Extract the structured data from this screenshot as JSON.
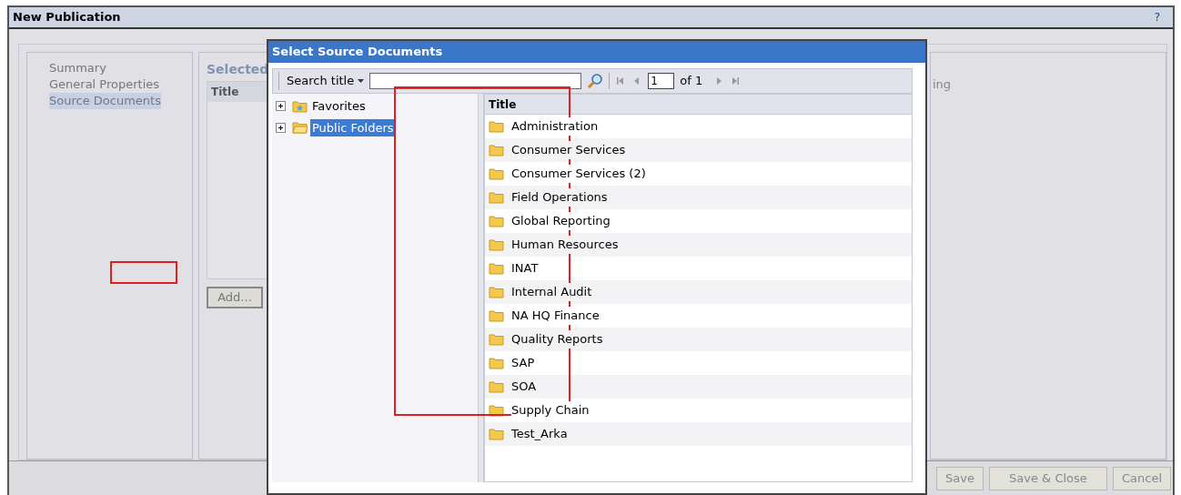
{
  "window": {
    "title": "New Publication",
    "help": "?"
  },
  "nav": {
    "items": [
      {
        "label": "Summary",
        "selected": false
      },
      {
        "label": "General Properties",
        "selected": false
      },
      {
        "label": "Source Documents",
        "selected": true
      }
    ]
  },
  "selected_panel": {
    "heading": "Selected",
    "column": "Title",
    "add_button": "Add..."
  },
  "right_panel": {
    "text_fragment": "ing"
  },
  "footer_buttons": [
    "Save",
    "Save & Close",
    "Cancel"
  ],
  "dialog": {
    "title": "Select Source Documents",
    "toolbar": {
      "search_label": "Search title",
      "page": "1",
      "page_total": "of 1"
    },
    "tree": [
      {
        "label": "Favorites",
        "kind": "favorites",
        "expanded": false,
        "selected": false
      },
      {
        "label": "Public Folders",
        "kind": "folder",
        "expanded": false,
        "selected": true
      }
    ],
    "list": {
      "column": "Title",
      "rows": [
        "Administration",
        "Consumer Services",
        "Consumer Services (2)",
        "Field Operations",
        "Global Reporting",
        "Human Resources",
        "INAT",
        "Internal Audit",
        "NA HQ Finance",
        "Quality Reports",
        "SAP",
        "SOA",
        "Supply Chain",
        "Test_Arka"
      ]
    }
  }
}
